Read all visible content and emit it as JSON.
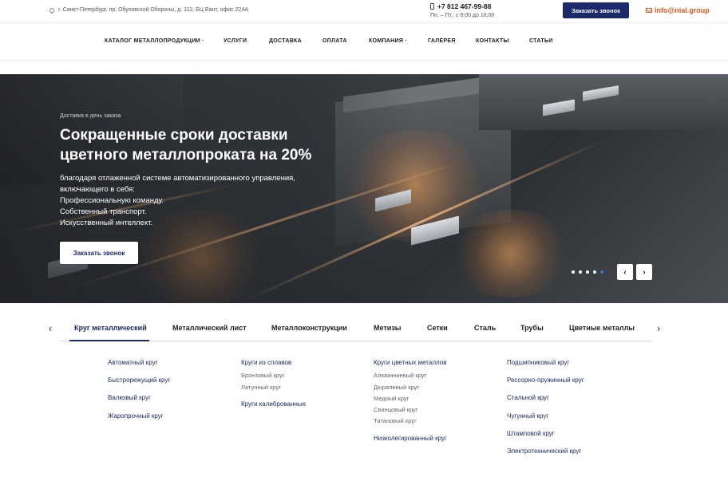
{
  "topbar": {
    "address": "г. Санкт-Петербург, пр. Обуховской Обороны, д. 112, БЦ Вант, офис 224А",
    "phone": "+7 812 467-99-88",
    "hours": "Пн. – Пт.: с 9:00 до 18:00",
    "call_button": "Заказать звонок",
    "email": "info@nial.group"
  },
  "nav": {
    "items": [
      {
        "label": "КАТАЛОГ МЕТАЛЛОПРОДУКЦИИ ·"
      },
      {
        "label": "УСЛУГИ"
      },
      {
        "label": "ДОСТАВКА"
      },
      {
        "label": "ОПЛАТА"
      },
      {
        "label": "КОМПАНИЯ ·"
      },
      {
        "label": "ГАЛЕРЕЯ"
      },
      {
        "label": "КОНТАКТЫ"
      },
      {
        "label": "СТАТЬИ"
      }
    ]
  },
  "hero": {
    "subtitle": "Доставка в день заказа",
    "title": "Сокращенные сроки доставки цветного металлопроката на 20%",
    "text_lines": [
      "благодаря отлаженной системе автоматизированного управления,",
      "включающего в себя:",
      "Профессиональную команду.",
      "Собственный транспорт.",
      "Искусственный интеллект."
    ],
    "button": "Заказать звонок",
    "prev_glyph": "‹",
    "next_glyph": "›",
    "slides_total": 5,
    "active_slide": 4
  },
  "tabs": {
    "items": [
      {
        "label": "Круг металлический"
      },
      {
        "label": "Металлический лист"
      },
      {
        "label": "Металлоконструкции"
      },
      {
        "label": "Метизы"
      },
      {
        "label": "Сетки"
      },
      {
        "label": "Сталь"
      },
      {
        "label": "Трубы"
      },
      {
        "label": "Цветные металлы"
      }
    ],
    "active_index": 0,
    "prev_glyph": "‹",
    "next_glyph": "›"
  },
  "categories": {
    "col1": [
      "Автоматный круг",
      "Быстрорежущий круг",
      "Валковый круг",
      "Жаропрочный круг"
    ],
    "col2": {
      "head": "Круги из сплавов",
      "subs": [
        "Бронзовый круг",
        "Латунный круг"
      ],
      "extra": "Круги калиброванные"
    },
    "col3": {
      "head": "Круги цветных металлов",
      "subs": [
        "Алюминиевый круг",
        "Дюралевый круг",
        "Медный круг",
        "Свинцовый круг",
        "Титановый круг"
      ],
      "extra": "Низколегированный круг"
    },
    "col4": [
      "Подшипниковый круг",
      "Рессорно-пружинный круг",
      "Стальной круг",
      "Чугунный круг",
      "Штамповой круг",
      "Электротехнический круг"
    ]
  }
}
